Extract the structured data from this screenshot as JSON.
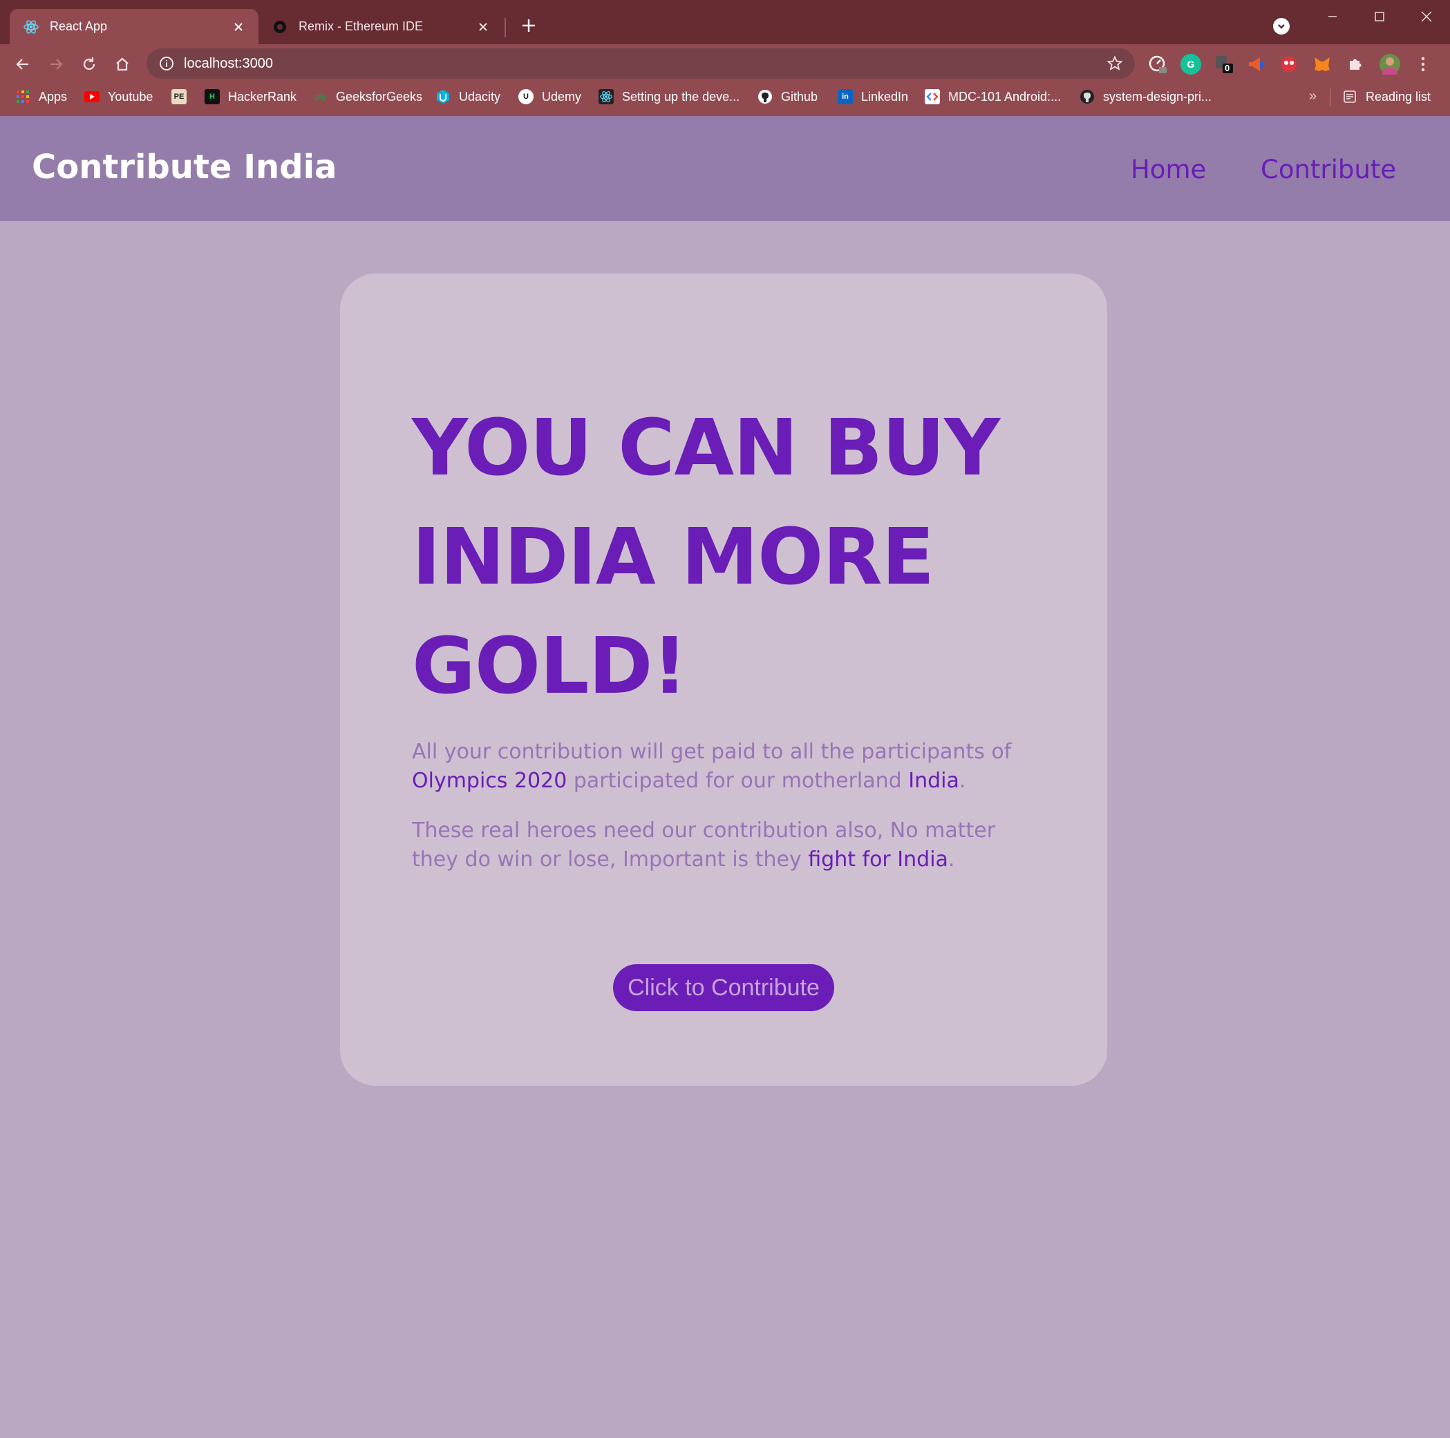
{
  "browser": {
    "tabs": [
      {
        "title": "React App",
        "active": true
      },
      {
        "title": "Remix - Ethereum IDE",
        "active": false
      }
    ],
    "address": "localhost:3000",
    "bookmarks": [
      {
        "label": "Apps",
        "icon": "apps-grid-icon"
      },
      {
        "label": "Youtube",
        "icon": "youtube-icon"
      },
      {
        "label": "",
        "icon": "pe-icon"
      },
      {
        "label": "HackerRank",
        "icon": "hackerrank-icon"
      },
      {
        "label": "GeeksforGeeks",
        "icon": "geeksforgeeks-icon"
      },
      {
        "label": "Udacity",
        "icon": "udacity-icon"
      },
      {
        "label": "Udemy",
        "icon": "udemy-icon"
      },
      {
        "label": "Setting up the deve...",
        "icon": "react-icon"
      },
      {
        "label": "Github",
        "icon": "github-icon"
      },
      {
        "label": "LinkedIn",
        "icon": "linkedin-icon"
      },
      {
        "label": "MDC-101 Android:...",
        "icon": "codelabs-icon"
      },
      {
        "label": "system-design-pri...",
        "icon": "github-icon"
      }
    ],
    "bookmarks_more": "»",
    "reading_list": "Reading list",
    "extension_badge": "0",
    "colors": {
      "frame": "#672b32",
      "toolbar": "#924a51",
      "omnibox": "#774247"
    }
  },
  "site": {
    "brand": "Contribute India",
    "nav": [
      "Home",
      "Contribute"
    ],
    "headline": "YOU CAN BUY INDIA MORE GOLD!",
    "para1": {
      "t1": "All your contribution will get paid to all the participants of ",
      "h1": "Olympics 2020",
      "t2": " participated for our motherland ",
      "h2": "India",
      "t3": "."
    },
    "para2": {
      "t1": "These real heroes need our contribution also, No matter they do win or lose, Important is they ",
      "h1": "fight for India",
      "t2": "."
    },
    "cta": "Click to Contribute",
    "colors": {
      "accent": "#6a1db7",
      "navbar": "#947dab",
      "background": "#baa8c3",
      "card": "#cfc0d1",
      "muted_text": "#9774b7"
    }
  }
}
